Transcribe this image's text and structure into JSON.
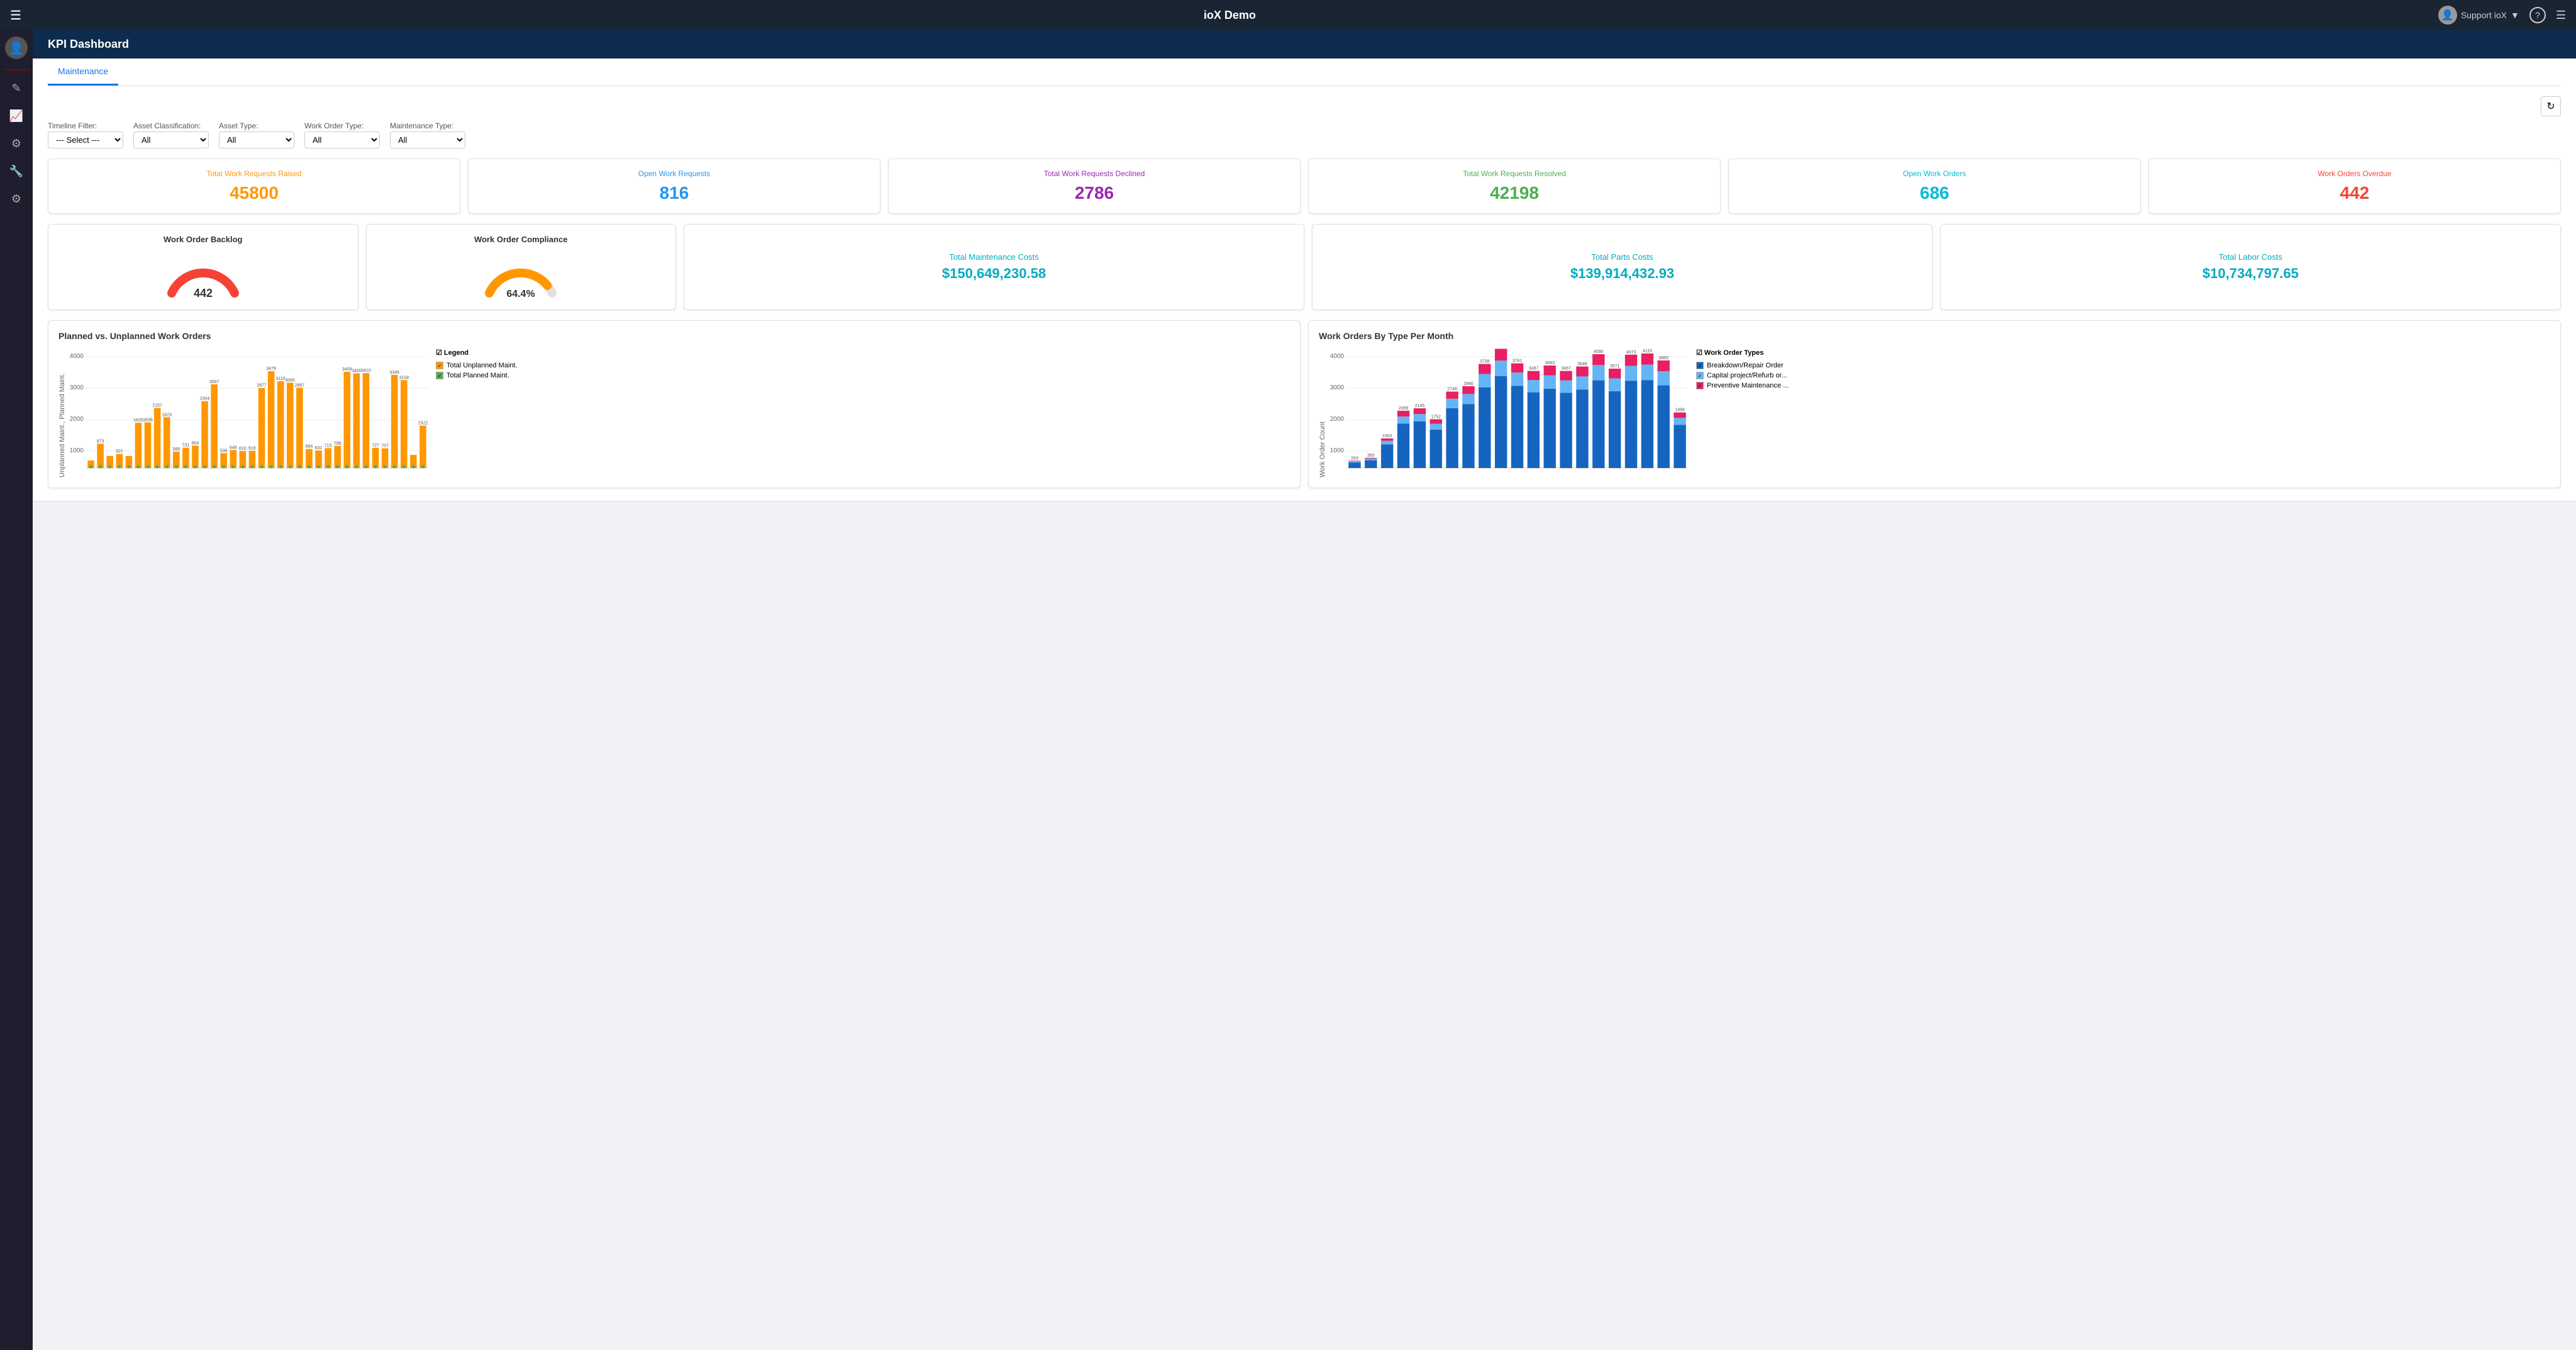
{
  "app": {
    "title": "ioX Demo",
    "user": "Support ioX"
  },
  "page": {
    "header": "KPI Dashboard"
  },
  "tabs": [
    {
      "label": "Maintenance",
      "active": true
    }
  ],
  "filters": {
    "timeline": {
      "label": "Timeline Filter:",
      "value": "--- Select ---",
      "options": [
        "--- Select ---"
      ]
    },
    "assetClassification": {
      "label": "Asset Classification:",
      "value": "All",
      "options": [
        "All"
      ]
    },
    "assetType": {
      "label": "Asset Type:",
      "value": "All",
      "options": [
        "All"
      ]
    },
    "workOrderType": {
      "label": "Work Order Type:",
      "value": "All",
      "options": [
        "All"
      ]
    },
    "maintenanceType": {
      "label": "Maintenance Type:",
      "value": "All",
      "options": [
        "All"
      ]
    }
  },
  "kpi_row1": [
    {
      "label": "Total Work Requests Raised",
      "value": "45800",
      "color": "orange"
    },
    {
      "label": "Open Work Requests",
      "value": "816",
      "color": "blue"
    },
    {
      "label": "Total Work Requests Declined",
      "value": "2786",
      "color": "purple"
    },
    {
      "label": "Total Work Requests Resolved",
      "value": "42198",
      "color": "green"
    },
    {
      "label": "Open Work Orders",
      "value": "686",
      "color": "teal"
    },
    {
      "label": "Work Orders Overdue",
      "value": "442",
      "color": "red"
    }
  ],
  "kpi_row2": [
    {
      "type": "gauge-red",
      "label": "Work Order Backlog",
      "value": "442"
    },
    {
      "type": "gauge-orange",
      "label": "Work Order Compliance",
      "value": "64.4%"
    },
    {
      "type": "cost",
      "label": "Total Maintenance Costs",
      "value": "$150,649,230.58",
      "color": "cyan"
    },
    {
      "type": "cost",
      "label": "Total Parts Costs",
      "value": "$139,914,432.93",
      "color": "cyan"
    },
    {
      "type": "cost",
      "label": "Total Labor Costs",
      "value": "$10,734,797.65",
      "color": "cyan"
    }
  ],
  "chart1": {
    "title": "Planned vs. Unplanned Work Orders",
    "yLabel": "Unplanned Maint., Planned Maint.",
    "legend": {
      "title": "Legend",
      "items": [
        {
          "label": "Total Unplanned Maint.",
          "color": "orange"
        },
        {
          "label": "Total Planned Maint.",
          "color": "green"
        }
      ]
    },
    "bars": [
      {
        "month": "",
        "unplanned": 270,
        "planned": 100
      },
      {
        "month": "",
        "unplanned": 873,
        "planned": 150
      },
      {
        "month": "",
        "unplanned": 434,
        "planned": 130
      },
      {
        "month": "",
        "unplanned": 507,
        "planned": 140
      },
      {
        "month": "",
        "unplanned": 429,
        "planned": 130
      },
      {
        "month": "",
        "unplanned": 1625,
        "planned": 160
      },
      {
        "month": "",
        "unplanned": 1638,
        "planned": 170
      },
      {
        "month": "",
        "unplanned": 2157,
        "planned": 180
      },
      {
        "month": "",
        "unplanned": 1823,
        "planned": 150
      },
      {
        "month": "",
        "unplanned": 589,
        "planned": 140
      },
      {
        "month": "",
        "unplanned": 731,
        "planned": 150
      },
      {
        "month": "",
        "unplanned": 804,
        "planned": 160
      },
      {
        "month": "",
        "unplanned": 2404,
        "planned": 180
      },
      {
        "month": "",
        "unplanned": 3007,
        "planned": 190
      },
      {
        "month": "",
        "unplanned": 536,
        "planned": 140
      },
      {
        "month": "",
        "unplanned": 646,
        "planned": 145
      },
      {
        "month": "",
        "unplanned": 610,
        "planned": 140
      },
      {
        "month": "",
        "unplanned": 618,
        "planned": 142
      },
      {
        "month": "",
        "unplanned": 2877,
        "planned": 185
      },
      {
        "month": "",
        "unplanned": 3479,
        "planned": 200
      },
      {
        "month": "",
        "unplanned": 3115,
        "planned": 195
      },
      {
        "month": "",
        "unplanned": 3065,
        "planned": 192
      },
      {
        "month": "",
        "unplanned": 2887,
        "planned": 185
      },
      {
        "month": "",
        "unplanned": 684,
        "planned": 148
      },
      {
        "month": "",
        "unplanned": 631,
        "planned": 145
      },
      {
        "month": "",
        "unplanned": 715,
        "planned": 150
      },
      {
        "month": "",
        "unplanned": 796,
        "planned": 155
      },
      {
        "month": "",
        "unplanned": 3459,
        "planned": 202
      },
      {
        "month": "",
        "unplanned": 3400,
        "planned": 200
      },
      {
        "month": "",
        "unplanned": 3410,
        "planned": 201
      },
      {
        "month": "",
        "unplanned": 727,
        "planned": 152
      },
      {
        "month": "",
        "unplanned": 707,
        "planned": 150
      },
      {
        "month": "",
        "unplanned": 3346,
        "planned": 198
      },
      {
        "month": "",
        "unplanned": 3158,
        "planned": 195
      },
      {
        "month": "",
        "unplanned": 474,
        "planned": 130
      },
      {
        "month": "",
        "unplanned": 1522,
        "planned": 165
      }
    ],
    "yMax": 4000
  },
  "chart2": {
    "title": "Work Orders By Type Per Month",
    "yLabel": "Work Order Count",
    "legend": {
      "title": "Work Order Types",
      "items": [
        {
          "label": "Breakdown/Repair Order",
          "color": "blue"
        },
        {
          "label": "Capital project/Refurb or...",
          "color": "lightblue"
        },
        {
          "label": "Preventive Maintenance ...",
          "color": "pink"
        }
      ]
    },
    "bars": [
      {
        "label": "263",
        "breakdown": 200,
        "capital": 50,
        "preventive": 13,
        "total": 263
      },
      {
        "label": "365",
        "breakdown": 280,
        "capital": 60,
        "preventive": 25,
        "total": 365
      },
      {
        "label": "1063",
        "breakdown": 850,
        "capital": 130,
        "preventive": 83,
        "total": 1063
      },
      {
        "label": "2059",
        "breakdown": 1600,
        "capital": 250,
        "preventive": 209,
        "total": 2059
      },
      {
        "label": "2145",
        "breakdown": 1680,
        "capital": 260,
        "preventive": 205,
        "total": 2145
      },
      {
        "label": "1752",
        "breakdown": 1380,
        "capital": 210,
        "preventive": 162,
        "total": 1752
      },
      {
        "label": "2746",
        "breakdown": 2150,
        "capital": 340,
        "preventive": 256,
        "total": 2746
      },
      {
        "label": "2940",
        "breakdown": 2300,
        "capital": 360,
        "preventive": 280,
        "total": 2940
      },
      {
        "label": "3738",
        "breakdown": 2900,
        "capital": 480,
        "preventive": 358,
        "total": 3738
      },
      {
        "label": "4283",
        "breakdown": 3300,
        "capital": 560,
        "preventive": 423,
        "total": 4283
      },
      {
        "label": "3761",
        "breakdown": 2950,
        "capital": 480,
        "preventive": 331,
        "total": 3761
      },
      {
        "label": "3487",
        "breakdown": 2720,
        "capital": 440,
        "preventive": 327,
        "total": 3487
      },
      {
        "label": "3683",
        "breakdown": 2850,
        "capital": 480,
        "preventive": 353,
        "total": 3683
      },
      {
        "label": "3487",
        "breakdown": 2700,
        "capital": 450,
        "preventive": 337,
        "total": 3487
      },
      {
        "label": "3648",
        "breakdown": 2820,
        "capital": 470,
        "preventive": 358,
        "total": 3648
      },
      {
        "label": "4090",
        "breakdown": 3150,
        "capital": 550,
        "preventive": 390,
        "total": 4090
      },
      {
        "label": "3571",
        "breakdown": 2760,
        "capital": 460,
        "preventive": 351,
        "total": 3571
      },
      {
        "label": "4073",
        "breakdown": 3130,
        "capital": 540,
        "preventive": 403,
        "total": 4073
      },
      {
        "label": "4115",
        "breakdown": 3160,
        "capital": 555,
        "preventive": 400,
        "total": 4115
      },
      {
        "label": "3865",
        "breakdown": 2970,
        "capital": 510,
        "preventive": 385,
        "total": 3865
      },
      {
        "label": "1996",
        "breakdown": 1550,
        "capital": 250,
        "preventive": 196,
        "total": 1996
      }
    ],
    "yMax": 4000
  },
  "colors": {
    "accent": "#1a73e8",
    "navBg": "#1a2533",
    "sidebarBg": "#1e1e2e",
    "pageBg": "#0d2b4e"
  }
}
